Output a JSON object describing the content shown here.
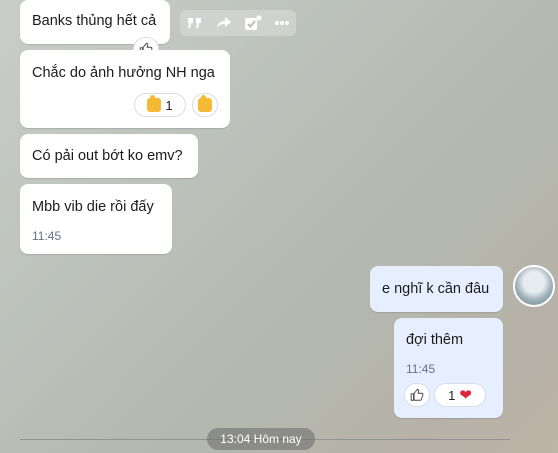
{
  "toolbar": {
    "quote_icon": "quote-icon",
    "forward_icon": "forward-icon",
    "task_icon": "checked-task-icon",
    "more_icon": "more-icon"
  },
  "messages": [
    {
      "text": "Banks thủng hết cả",
      "side": "incoming"
    },
    {
      "text": "Chắc do ảnh hưởng NH nga",
      "side": "incoming",
      "reaction_count": "1"
    },
    {
      "text": "Có pải out bớt ko emv?",
      "side": "incoming"
    },
    {
      "text": "Mbb vib die rồi đấy",
      "side": "incoming",
      "time": "11:45"
    },
    {
      "text": "e nghĩ k cần đâu",
      "side": "outgoing"
    },
    {
      "text": "đợi thêm",
      "side": "outgoing",
      "time": "11:45",
      "reaction_count": "1"
    }
  ],
  "date_separator": "13:04 Hôm nay",
  "colors": {
    "incoming_bubble": "#ffffff",
    "outgoing_bubble": "#e5efff",
    "heart": "#e0243b"
  }
}
